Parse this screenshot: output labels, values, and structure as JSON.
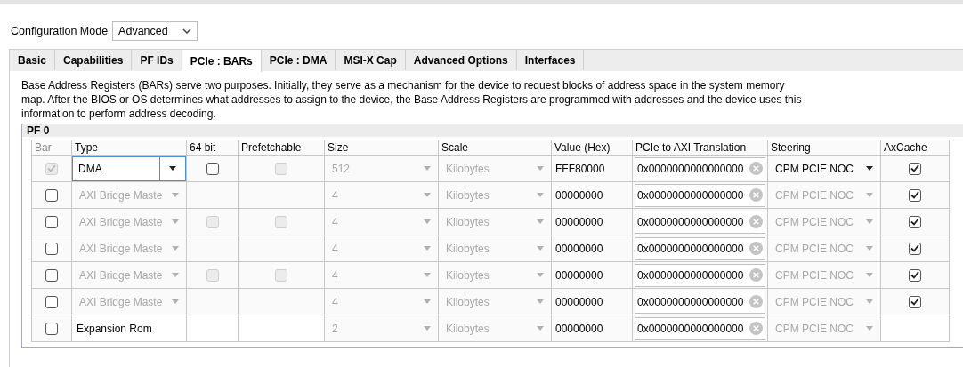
{
  "config_mode": {
    "label": "Configuration Mode",
    "value": "Advanced"
  },
  "tabs": [
    {
      "label": "Basic",
      "selected": false
    },
    {
      "label": "Capabilities",
      "selected": false
    },
    {
      "label": "PF IDs",
      "selected": false
    },
    {
      "label": "PCIe : BARs",
      "selected": true
    },
    {
      "label": "PCIe : DMA",
      "selected": false
    },
    {
      "label": "MSI-X Cap",
      "selected": false
    },
    {
      "label": "Advanced Options",
      "selected": false
    },
    {
      "label": "Interfaces",
      "selected": false
    }
  ],
  "description": "Base Address Registers (BARs) serve two purposes. Initially, they serve as a mechanism for the device to request blocks of address space in the system memory map. After the BIOS or OS determines what addresses to assign to the device, the Base Address Registers are programmed with addresses and the device uses this information to perform address decoding.",
  "group_title": "PF 0",
  "table": {
    "columns": [
      "Bar",
      "Type",
      "64 bit",
      "Prefetchable",
      "Size",
      "Scale",
      "Value (Hex)",
      "PCIe to AXI Translation",
      "Steering",
      "AxCache"
    ],
    "rows": [
      {
        "bar": {
          "checked": true,
          "disabled": true
        },
        "type": {
          "kind": "dropdown",
          "value": "DMA",
          "disabled": false,
          "focused": true
        },
        "bit64": {
          "checked": false,
          "disabled": false
        },
        "prefetchable": {
          "checked": false,
          "disabled": true
        },
        "size": {
          "value": "512",
          "disabled": true
        },
        "scale": {
          "value": "Kilobytes",
          "disabled": true
        },
        "value_hex": "FFF80000",
        "translation": "0x0000000000000000",
        "steering": {
          "value": "CPM PCIE NOC",
          "disabled": false
        },
        "axcache": {
          "checked": true,
          "disabled": false
        }
      },
      {
        "bar": {
          "checked": false,
          "disabled": false
        },
        "type": {
          "kind": "dropdown",
          "value": "AXI Bridge Maste",
          "disabled": true
        },
        "size": {
          "value": "4",
          "disabled": true
        },
        "scale": {
          "value": "Kilobytes",
          "disabled": true
        },
        "value_hex": "00000000",
        "translation": "0x0000000000000000",
        "steering": {
          "value": "CPM PCIE NOC",
          "disabled": true
        },
        "axcache": {
          "checked": true,
          "disabled": false
        }
      },
      {
        "bar": {
          "checked": false,
          "disabled": false
        },
        "type": {
          "kind": "dropdown",
          "value": "AXI Bridge Maste",
          "disabled": true
        },
        "bit64": {
          "checked": false,
          "disabled": true
        },
        "prefetchable": {
          "checked": false,
          "disabled": true
        },
        "size": {
          "value": "4",
          "disabled": true
        },
        "scale": {
          "value": "Kilobytes",
          "disabled": true
        },
        "value_hex": "00000000",
        "translation": "0x0000000000000000",
        "steering": {
          "value": "CPM PCIE NOC",
          "disabled": true
        },
        "axcache": {
          "checked": true,
          "disabled": false
        }
      },
      {
        "bar": {
          "checked": false,
          "disabled": false
        },
        "type": {
          "kind": "dropdown",
          "value": "AXI Bridge Maste",
          "disabled": true
        },
        "size": {
          "value": "4",
          "disabled": true
        },
        "scale": {
          "value": "Kilobytes",
          "disabled": true
        },
        "value_hex": "00000000",
        "translation": "0x0000000000000000",
        "steering": {
          "value": "CPM PCIE NOC",
          "disabled": true
        },
        "axcache": {
          "checked": true,
          "disabled": false
        }
      },
      {
        "bar": {
          "checked": false,
          "disabled": false
        },
        "type": {
          "kind": "dropdown",
          "value": "AXI Bridge Maste",
          "disabled": true
        },
        "bit64": {
          "checked": false,
          "disabled": true
        },
        "prefetchable": {
          "checked": false,
          "disabled": true
        },
        "size": {
          "value": "4",
          "disabled": true
        },
        "scale": {
          "value": "Kilobytes",
          "disabled": true
        },
        "value_hex": "00000000",
        "translation": "0x0000000000000000",
        "steering": {
          "value": "CPM PCIE NOC",
          "disabled": true
        },
        "axcache": {
          "checked": true,
          "disabled": false
        }
      },
      {
        "bar": {
          "checked": false,
          "disabled": false
        },
        "type": {
          "kind": "dropdown",
          "value": "AXI Bridge Maste",
          "disabled": true
        },
        "size": {
          "value": "4",
          "disabled": true
        },
        "scale": {
          "value": "Kilobytes",
          "disabled": true
        },
        "value_hex": "00000000",
        "translation": "0x0000000000000000",
        "steering": {
          "value": "CPM PCIE NOC",
          "disabled": true
        },
        "axcache": {
          "checked": true,
          "disabled": false
        }
      },
      {
        "bar": {
          "checked": false,
          "disabled": false
        },
        "type": {
          "kind": "text",
          "value": "Expansion Rom"
        },
        "size": {
          "value": "2",
          "disabled": true
        },
        "scale": {
          "value": "Kilobytes",
          "disabled": true
        },
        "value_hex": "00000000",
        "translation": "0x0000000000000000",
        "steering": {
          "value": "CPM PCIE NOC",
          "disabled": true
        }
      }
    ]
  }
}
